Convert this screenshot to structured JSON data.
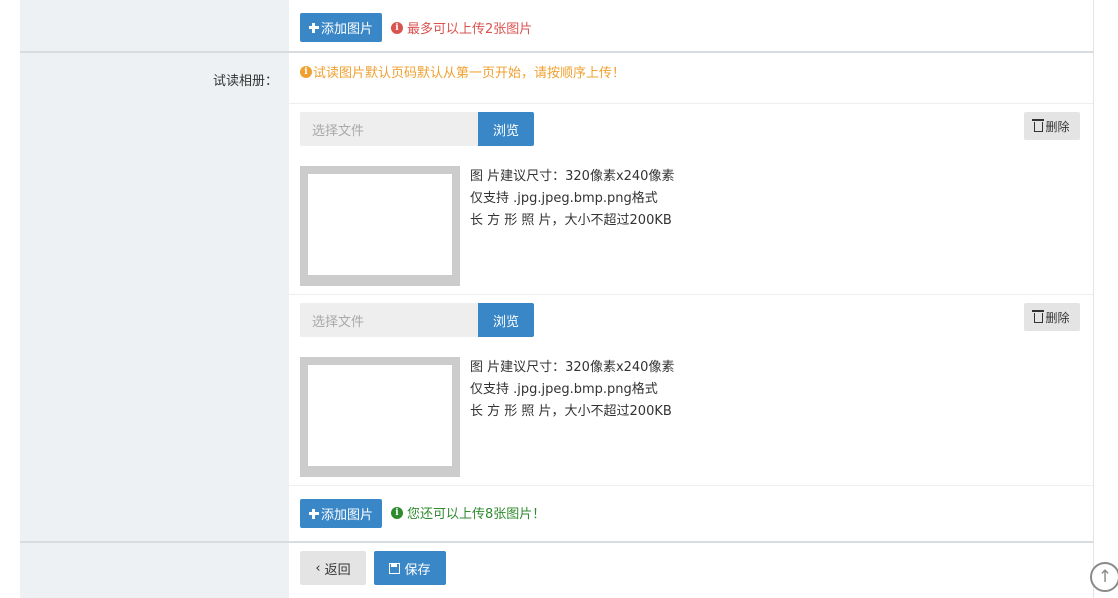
{
  "top_row": {
    "add_image_label": "添加图片",
    "limit_note": "最多可以上传2张图片"
  },
  "trial_section": {
    "label": "试读相册：",
    "notice": "试读图片默认页码默认从第一页开始，请按顺序上传！",
    "uploads": [
      {
        "file_placeholder": "选择文件",
        "browse_label": "浏览",
        "delete_label": "删除",
        "tips": [
          "图 片建议尺寸：320像素x240像素",
          "仅支持 .jpg.jpeg.bmp.png格式",
          "长 方 形 照 片，大小不超过200KB"
        ]
      },
      {
        "file_placeholder": "选择文件",
        "browse_label": "浏览",
        "delete_label": "删除",
        "tips": [
          "图 片建议尺寸：320像素x240像素",
          "仅支持 .jpg.jpeg.bmp.png格式",
          "长 方 形 照 片，大小不超过200KB"
        ]
      }
    ],
    "add_image_label": "添加图片",
    "remaining_note": "您还可以上传8张图片！"
  },
  "footer": {
    "back_label": "返回",
    "save_label": "保存"
  },
  "colors": {
    "primary": "#3a87c8",
    "danger": "#d9534f",
    "warning": "#f0a030",
    "success": "#2e8b2e"
  }
}
